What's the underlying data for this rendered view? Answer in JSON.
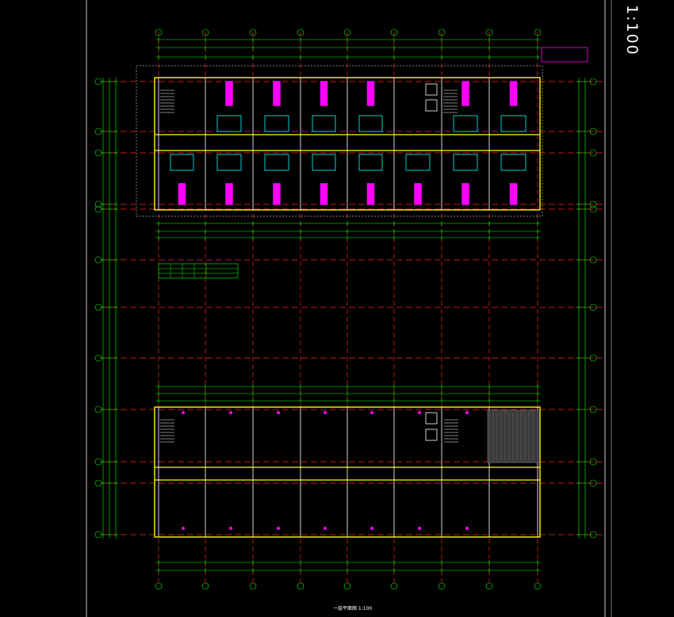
{
  "drawing": {
    "scale_text": "1:100",
    "sheet_title": "一层平面图 1:100",
    "colors": {
      "background": "#000000",
      "grid_axis": "#ff2020",
      "dimension": "#00ff00",
      "wall": "#ffff00",
      "fixture": "#00ffff",
      "magenta": "#ff00ff",
      "white": "#ffffff",
      "border": "#c8c8c8"
    },
    "icons": [
      "stair-icon",
      "elevator-icon",
      "column-icon",
      "door-swing-icon",
      "axis-bubble-icon"
    ]
  }
}
